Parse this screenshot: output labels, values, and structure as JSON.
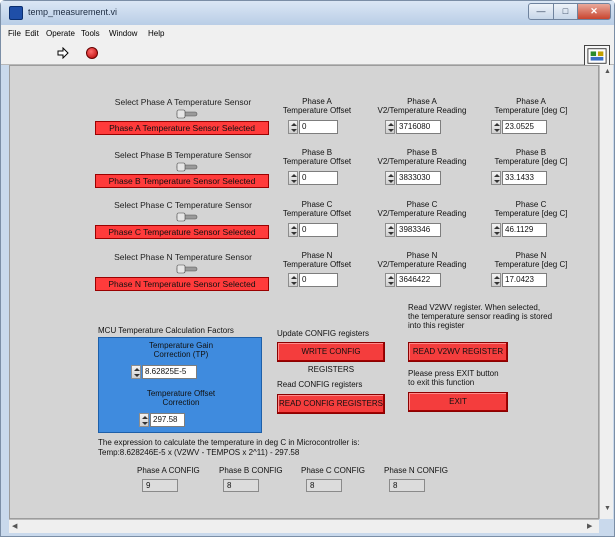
{
  "window": {
    "title": "temp_measurement.vi"
  },
  "menu": [
    "File",
    "Edit",
    "Operate",
    "Tools",
    "Window",
    "Help"
  ],
  "phases": [
    {
      "select_label": "Select Phase A Temperature Sensor",
      "indicator": "Phase A Temperature Sensor Selected",
      "offset_label": "Phase A\nTemperature Offset",
      "offset_value": "0",
      "reading_label": "Phase A\nV2/Temperature Reading",
      "reading_value": "3716080",
      "temp_label": "Phase A\nTemperature [deg C]",
      "temp_value": "23.0525"
    },
    {
      "select_label": "Select Phase B Temperature Sensor",
      "indicator": "Phase B Temperature Sensor Selected",
      "offset_label": "Phase B\nTemperature Offset",
      "offset_value": "0",
      "reading_label": "Phase B\nV2/Temperature Reading",
      "reading_value": "3833030",
      "temp_label": "Phase B\nTemperature [deg C]",
      "temp_value": "33.1433"
    },
    {
      "select_label": "Select Phase C Temperature Sensor",
      "indicator": "Phase C Temperature Sensor Selected",
      "offset_label": "Phase C\nTemperature Offset",
      "offset_value": "0",
      "reading_label": "Phase C\nV2/Temperature Reading",
      "reading_value": "3983346",
      "temp_label": "Phase C\nTemperature [deg C]",
      "temp_value": "46.1129"
    },
    {
      "select_label": "Select Phase N Temperature Sensor",
      "indicator": "Phase N Temperature Sensor Selected",
      "offset_label": "Phase N\nTemperature Offset",
      "offset_value": "0",
      "reading_label": "Phase N\nV2/Temperature Reading",
      "reading_value": "3646422",
      "temp_label": "Phase N\nTemperature [deg C]",
      "temp_value": "17.0423"
    }
  ],
  "mcu": {
    "heading": "MCU Temperature Calculation Factors",
    "gain_label": "Temperature Gain\nCorrection (TP)",
    "gain_value": "8.62825E-5",
    "offset_label": "Temperature Offset\nCorrection",
    "offset_value": "297.58"
  },
  "config": {
    "update_label": "Update CONFIG registers",
    "write_button": "WRITE CONFIG REGISTERS",
    "read_label": "Read CONFIG registers",
    "read_button": "READ CONFIG REGISTERS"
  },
  "v2wv": {
    "description": "Read V2WV register. When selected,\nthe temperature sensor reading is stored\ninto this register",
    "button": "READ V2WV REGISTER"
  },
  "exit": {
    "description": "Please press EXIT button\nto exit this function",
    "button": "EXIT"
  },
  "expression": {
    "line1": "The expression to calculate the temperature in deg C in Microcontroller is:",
    "line2": "Temp:8.628246E-5 x (V2WV - TEMPOS x 2^11) - 297.58"
  },
  "phase_configs": [
    {
      "label": "Phase A CONFIG",
      "value": "9"
    },
    {
      "label": "Phase B CONFIG",
      "value": "8"
    },
    {
      "label": "Phase C CONFIG",
      "value": "8"
    },
    {
      "label": "Phase N CONFIG",
      "value": "8"
    }
  ],
  "colors": {
    "indicator_red": "#ff3b3b",
    "button_red": "#f43d3d",
    "mcu_blue": "#3f8bde",
    "panel_gray": "#d4d4d4"
  }
}
